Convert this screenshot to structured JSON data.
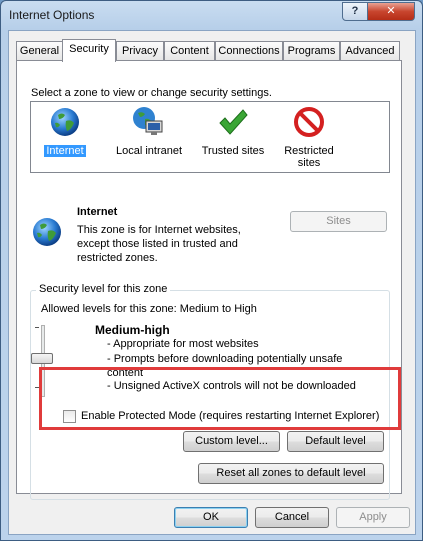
{
  "window": {
    "title": "Internet Options",
    "help_label": "?",
    "close_label": "✕"
  },
  "tabs": [
    {
      "label": "General",
      "active": false
    },
    {
      "label": "Security",
      "active": true
    },
    {
      "label": "Privacy",
      "active": false
    },
    {
      "label": "Content",
      "active": false
    },
    {
      "label": "Connections",
      "active": false
    },
    {
      "label": "Programs",
      "active": false
    },
    {
      "label": "Advanced",
      "active": false
    }
  ],
  "security": {
    "prompt": "Select a zone to view or change security settings.",
    "zones": [
      {
        "name": "Internet",
        "icon": "globe-icon",
        "selected": true
      },
      {
        "name": "Local intranet",
        "icon": "intranet-icon",
        "selected": false
      },
      {
        "name": "Trusted sites",
        "icon": "checkmark-icon",
        "selected": false
      },
      {
        "name": "Restricted sites",
        "icon": "restricted-icon",
        "selected": false
      }
    ],
    "zone_detail": {
      "title": "Internet",
      "description": "This zone is for Internet websites, except those listed in trusted and restricted zones.",
      "sites_button": "Sites"
    },
    "level": {
      "group_title": "Security level for this zone",
      "allowed": "Allowed levels for this zone: Medium to High",
      "name": "Medium-high",
      "bullets": [
        "- Appropriate for most websites",
        "- Prompts before downloading potentially unsafe content",
        "- Unsigned ActiveX controls will not be downloaded"
      ]
    },
    "protected_mode": {
      "label": "Enable Protected Mode (requires restarting Internet Explorer)",
      "checked": false
    },
    "custom_level_button": "Custom level...",
    "default_level_button": "Default level",
    "reset_all_button": "Reset all zones to default level"
  },
  "footer": {
    "ok": "OK",
    "cancel": "Cancel",
    "apply": "Apply"
  },
  "colors": {
    "highlight": "#e03b3b",
    "selection": "#3399ff",
    "window_frame": "#bcd3ec"
  }
}
